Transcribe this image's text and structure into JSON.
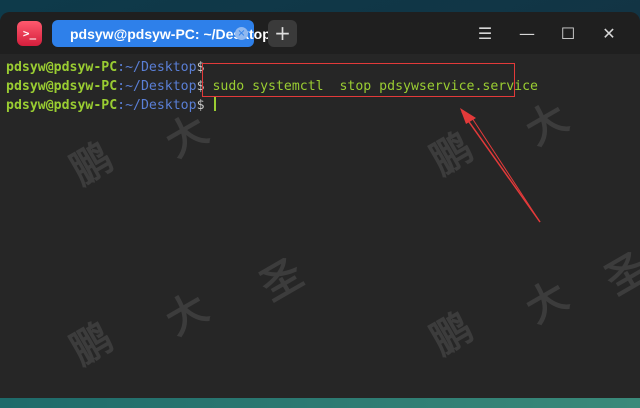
{
  "app": {
    "icon_glyph": ">_"
  },
  "tab": {
    "label": "pdsyw@pdsyw-PC: ~/Desktop",
    "close_glyph": "×"
  },
  "new_tab_glyph": "+",
  "window_controls": {
    "menu": "☰",
    "minimize": "—",
    "maximize": "☐",
    "close": "✕"
  },
  "terminal": {
    "lines": [
      {
        "user": "pdsyw@pdsyw-PC",
        "path": ":~/Desktop",
        "dollar": "$",
        "command": ""
      },
      {
        "user": "pdsyw@pdsyw-PC",
        "path": ":~/Desktop",
        "dollar": "$",
        "command": " sudo systemctl  stop pdsywservice.service"
      },
      {
        "user": "pdsyw@pdsyw-PC",
        "path": ":~/Desktop",
        "dollar": "$",
        "command": " "
      }
    ]
  },
  "watermark_char": {
    "a": "鹏",
    "b": "大",
    "c": "圣"
  },
  "colors": {
    "accent_tab": "#2e80ea",
    "annotation": "#e23a3a",
    "prompt_user": "#9acd32",
    "prompt_path": "#5a7fd6"
  }
}
